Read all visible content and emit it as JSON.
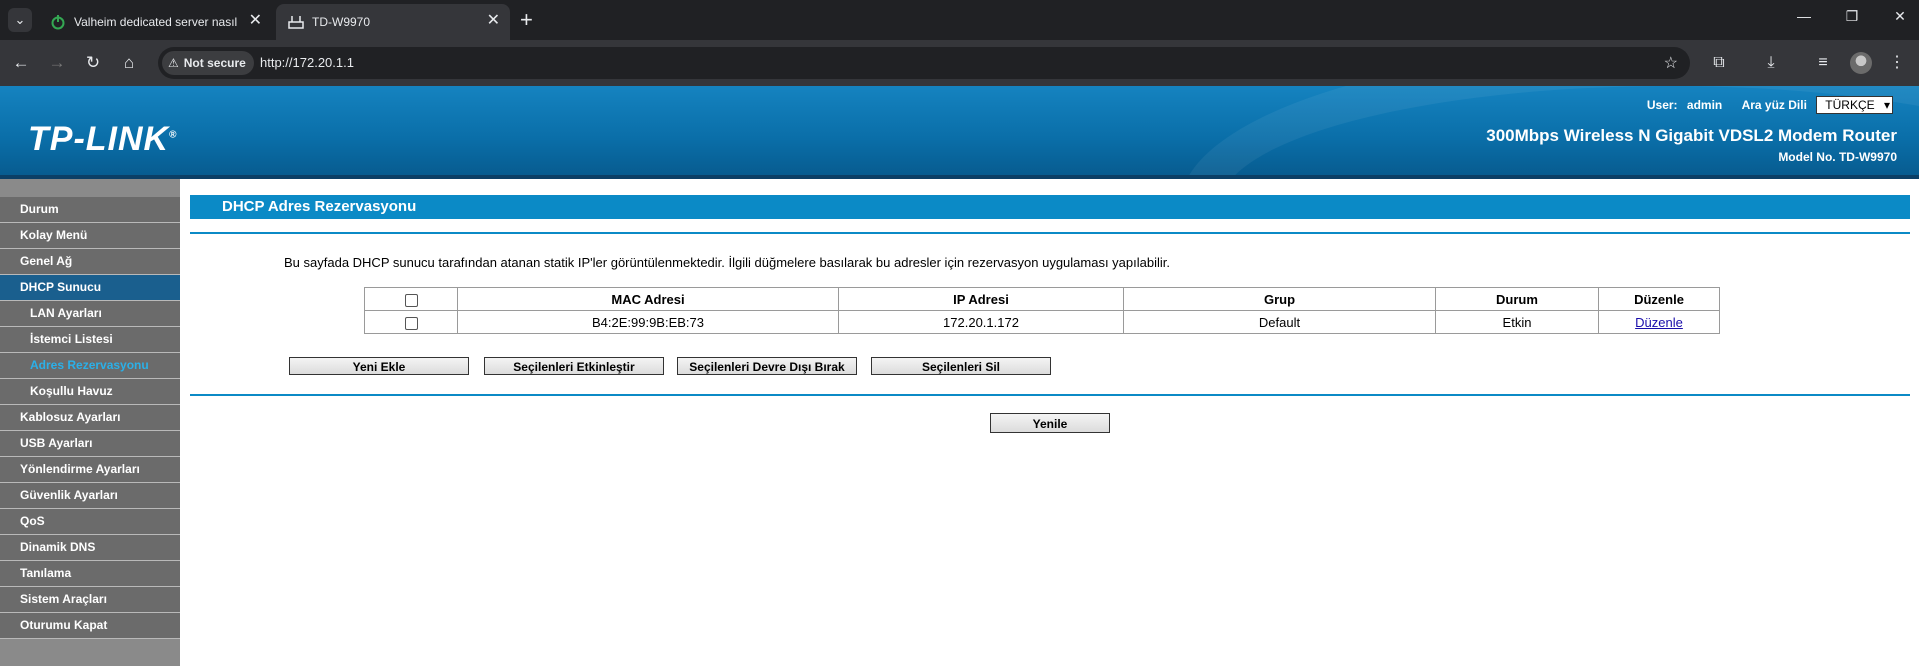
{
  "browser": {
    "tabs": [
      {
        "title": "Valheim dedicated server nasıl k",
        "active": false
      },
      {
        "title": "TD-W9970",
        "active": true
      }
    ],
    "security_label": "Not secure",
    "url": "http://172.20.1.1"
  },
  "router": {
    "logo": "TP-LINK",
    "logo_mark": "®",
    "user_label": "User:",
    "user_name": "admin",
    "lang_label": "Ara yüz Dili",
    "lang_value": "TÜRKÇE",
    "product": "300Mbps Wireless N Gigabit VDSL2 Modem Router",
    "model": "Model No. TD-W9970"
  },
  "sidebar": {
    "items": [
      {
        "label": "Durum",
        "type": "main"
      },
      {
        "label": "Kolay Menü",
        "type": "main"
      },
      {
        "label": "Genel Ağ",
        "type": "main"
      },
      {
        "label": "DHCP Sunucu",
        "type": "active"
      },
      {
        "label": "LAN Ayarları",
        "type": "sub"
      },
      {
        "label": "İstemci Listesi",
        "type": "sub"
      },
      {
        "label": "Adres Rezervasyonu",
        "type": "current"
      },
      {
        "label": "Koşullu Havuz",
        "type": "sub"
      },
      {
        "label": "Kablosuz Ayarları",
        "type": "main"
      },
      {
        "label": "USB Ayarları",
        "type": "main"
      },
      {
        "label": "Yönlendirme Ayarları",
        "type": "main"
      },
      {
        "label": "Güvenlik Ayarları",
        "type": "main"
      },
      {
        "label": "QoS",
        "type": "main"
      },
      {
        "label": "Dinamik DNS",
        "type": "main"
      },
      {
        "label": "Tanılama",
        "type": "main"
      },
      {
        "label": "Sistem Araçları",
        "type": "main"
      },
      {
        "label": "Oturumu Kapat",
        "type": "main"
      }
    ]
  },
  "main": {
    "title": "DHCP Adres Rezervasyonu",
    "description": "Bu sayfada DHCP sunucu tarafından atanan statik IP'ler görüntülenmektedir. İlgili düğmelere basılarak bu adresler için rezervasyon uygulaması yapılabilir.",
    "table": {
      "headers": [
        "MAC Adresi",
        "IP Adresi",
        "Grup",
        "Durum",
        "Düzenle"
      ],
      "rows": [
        {
          "mac": "B4:2E:99:9B:EB:73",
          "ip": "172.20.1.172",
          "group": "Default",
          "status": "Etkin",
          "edit": "Düzenle"
        }
      ]
    },
    "buttons": {
      "add": "Yeni Ekle",
      "enable": "Seçilenleri Etkinleştir",
      "disable": "Seçilenleri Devre Dışı Bırak",
      "delete": "Seçilenleri Sil",
      "refresh": "Yenile"
    }
  }
}
